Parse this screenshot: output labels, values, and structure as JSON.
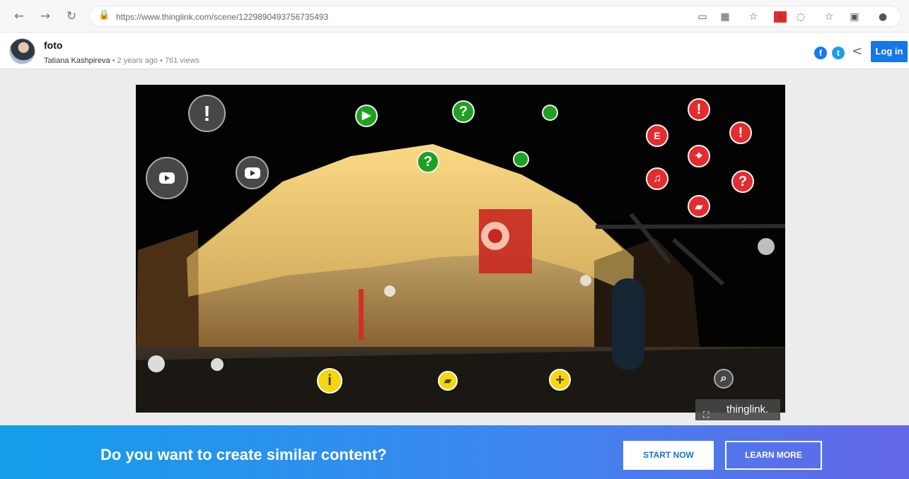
{
  "browser": {
    "url": "https://www.thinglink.com/scene/1229890493756735493"
  },
  "post": {
    "title": "foto",
    "author": "Tatiana Kashpireva",
    "age": "2 years ago",
    "views": "761 views"
  },
  "header": {
    "login_label": "Log in",
    "facebook_letter": "f",
    "twitter_letter": "t"
  },
  "scene": {
    "hotspots": [
      {
        "kind": "gray",
        "symbol": "!",
        "name": "exclamation-hotspot-icon"
      },
      {
        "kind": "gray",
        "symbol": "",
        "name": "video-hotspot-icon"
      },
      {
        "kind": "gray",
        "symbol": "",
        "name": "video-hotspot-icon-2"
      },
      {
        "kind": "green",
        "symbol": "▶",
        "name": "play-hotspot-icon"
      },
      {
        "kind": "green",
        "symbol": "?",
        "name": "question-hotspot-icon"
      },
      {
        "kind": "green",
        "symbol": "?",
        "name": "question-hotspot-icon-2"
      },
      {
        "kind": "green",
        "symbol": "",
        "name": "dot-hotspot-icon"
      },
      {
        "kind": "green",
        "symbol": "",
        "name": "dot-hotspot-icon-2"
      },
      {
        "kind": "red",
        "symbol": "!",
        "name": "red-exclamation-icon"
      },
      {
        "kind": "red",
        "symbol": "!",
        "name": "red-exclamation-icon-2"
      },
      {
        "kind": "red",
        "symbol": "E",
        "name": "text-hotspot-icon"
      },
      {
        "kind": "red",
        "symbol": "⌖",
        "name": "location-hotspot-icon"
      },
      {
        "kind": "red",
        "symbol": "♫",
        "name": "music-hotspot-icon"
      },
      {
        "kind": "red",
        "symbol": "?",
        "name": "red-question-icon"
      },
      {
        "kind": "red",
        "symbol": "▰",
        "name": "book-hotspot-icon"
      },
      {
        "kind": "yellow",
        "symbol": "i",
        "name": "info-hotspot-icon"
      },
      {
        "kind": "yellow",
        "symbol": "▰",
        "name": "yellow-book-hotspot-icon"
      },
      {
        "kind": "yellow",
        "symbol": "+",
        "name": "add-hotspot-icon"
      },
      {
        "kind": "gray",
        "symbol": "⌕",
        "name": "search-hotspot-icon"
      }
    ],
    "credit": "thinglink.",
    "fullscreen": "⛶"
  },
  "banner": {
    "text": "Do you want to create similar content?",
    "start": "START NOW",
    "learn": "LEARN MORE"
  }
}
